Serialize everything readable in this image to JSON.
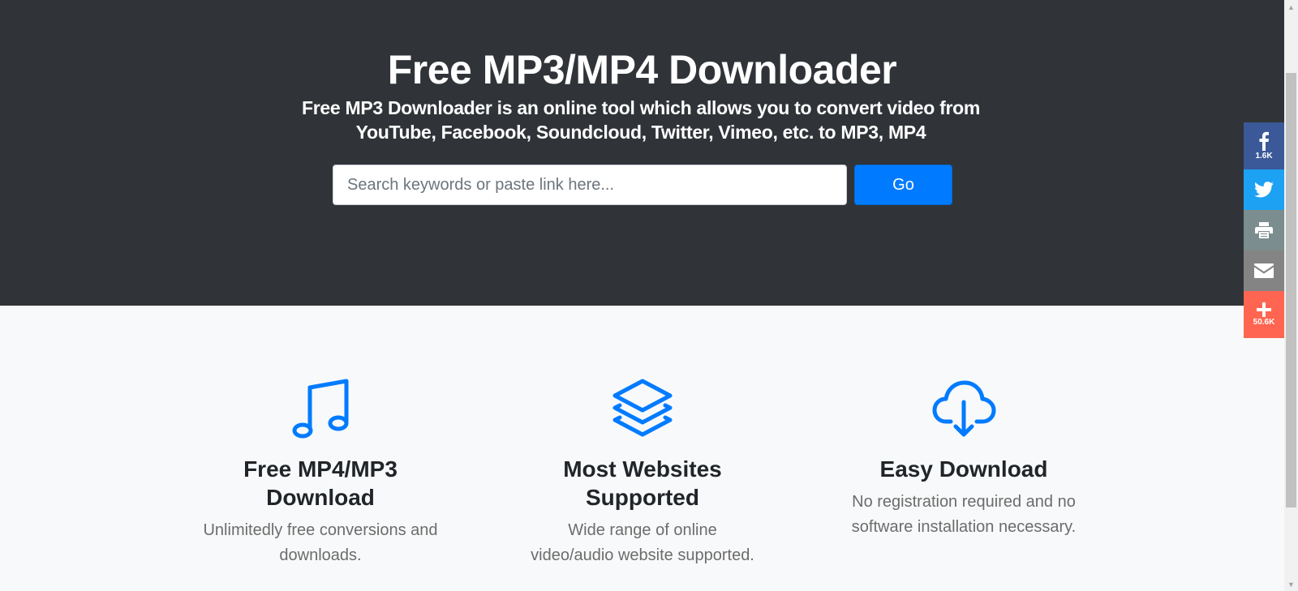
{
  "hero": {
    "title": "Free MP3/MP4 Downloader",
    "subtitle": "Free MP3 Downloader is an online tool which allows you to convert video from YouTube, Facebook, Soundcloud, Twitter, Vimeo, etc. to MP3, MP4",
    "search_placeholder": "Search keywords or paste link here...",
    "search_value": "",
    "go_label": "Go"
  },
  "features": [
    {
      "icon": "music-note-icon",
      "title": "Free MP4/MP3 Download",
      "text": "Unlimitedly free conversions and downloads."
    },
    {
      "icon": "layers-icon",
      "title": "Most Websites Supported",
      "text": "Wide range of online video/audio website supported."
    },
    {
      "icon": "cloud-download-icon",
      "title": "Easy Download",
      "text": "No registration required and no software installation necessary."
    }
  ],
  "share": {
    "facebook_count": "1.6K",
    "more_count": "50.6K"
  },
  "colors": {
    "hero_bg": "#303438",
    "accent": "#007bff",
    "facebook": "#3b5998",
    "twitter": "#1da1f2",
    "print": "#7b8d8e",
    "email": "#848484",
    "more": "#ff6550"
  }
}
